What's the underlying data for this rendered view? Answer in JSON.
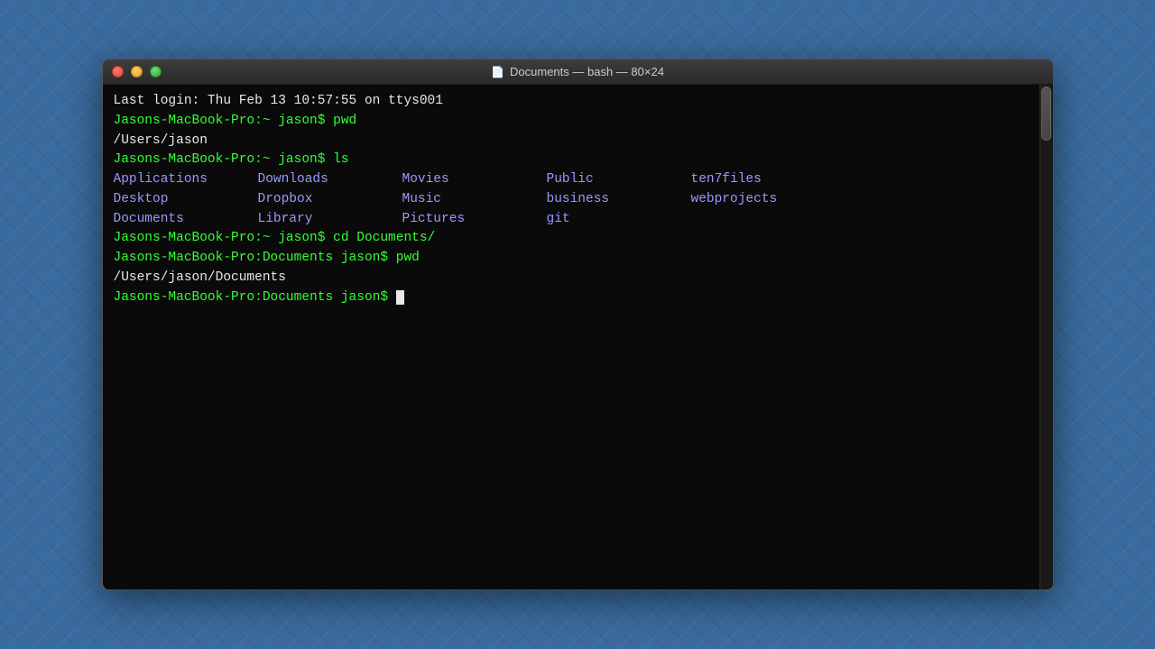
{
  "window": {
    "title": "Documents — bash — 80×24",
    "icon": "📄"
  },
  "terminal": {
    "login_line": "Last login: Thu Feb 13 10:57:55 on ttys001",
    "lines": [
      {
        "type": "prompt",
        "text": "Jasons-MacBook-Pro:~ jason$ pwd"
      },
      {
        "type": "output",
        "text": "/Users/jason"
      },
      {
        "type": "prompt",
        "text": "Jasons-MacBook-Pro:~ jason$ ls"
      },
      {
        "type": "ls",
        "items": [
          "Applications",
          "Downloads",
          "Movies",
          "Public",
          "ten7files",
          "Desktop",
          "Dropbox",
          "Music",
          "business",
          "webprojects",
          "Documents",
          "Library",
          "Pictures",
          "git",
          ""
        ]
      },
      {
        "type": "prompt",
        "text": "Jasons-MacBook-Pro:~ jason$ cd Documents/"
      },
      {
        "type": "prompt",
        "text": "Jasons-MacBook-Pro:Documents jason$ pwd"
      },
      {
        "type": "output",
        "text": "/Users/jason/Documents"
      },
      {
        "type": "prompt_cursor",
        "text": "Jasons-MacBook-Pro:Documents jason$ "
      }
    ]
  },
  "traffic_lights": {
    "close_label": "close",
    "minimize_label": "minimize",
    "maximize_label": "maximize"
  }
}
